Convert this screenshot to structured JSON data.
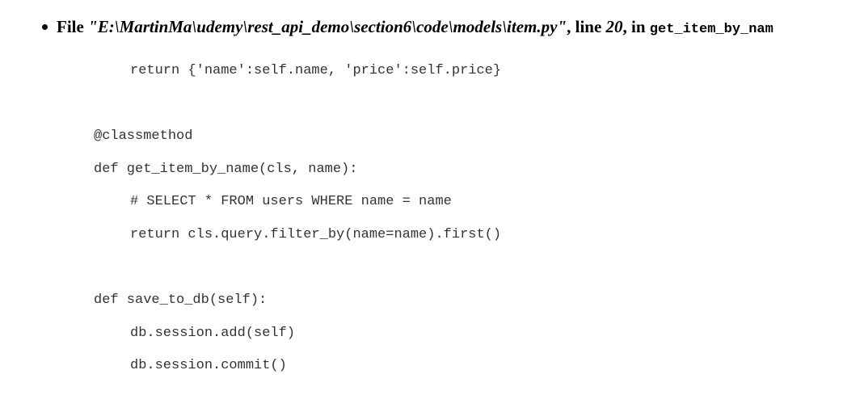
{
  "frame": {
    "file_label": "File",
    "file_path": "\"E:\\MartinMa\\udemy\\rest_api_demo\\section6\\code\\models\\item.py\"",
    "line_label": ", line",
    "line_number": "20",
    "in_label": ", in",
    "function_name": "get_item_by_nam"
  },
  "code_lines": [
    "return {'name':self.name, 'price':self.price}",
    "@classmethod",
    "def get_item_by_name(cls, name):",
    "# SELECT * FROM users WHERE name = name",
    "return cls.query.filter_by(name=name).first()",
    "def save_to_db(self):",
    "db.session.add(self)",
    "db.session.commit()"
  ]
}
